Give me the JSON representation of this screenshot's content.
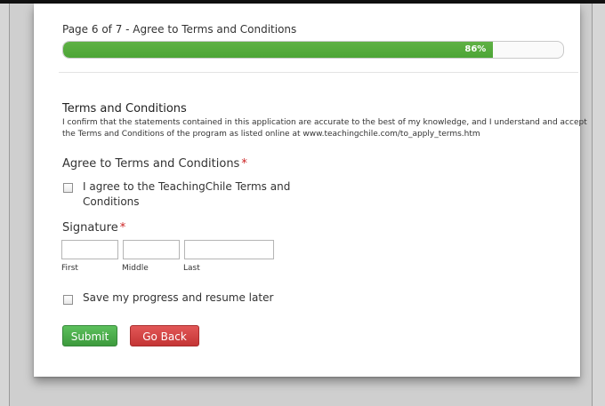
{
  "form": {
    "page_title": "Page 6 of 7 - Agree to Terms and Conditions",
    "progress": {
      "percent": 86,
      "label": "86%",
      "color": "#4ca536"
    },
    "terms_section": {
      "heading": "Terms and Conditions",
      "description": "I confirm that the statements contained in this application are accurate to the best of my knowledge, and I understand and accept the Terms and Conditions of the program as listed online at www.teachingchile.com/to_apply_terms.htm"
    },
    "agree_field": {
      "label": "Agree to Terms and Conditions",
      "required_mark": "*",
      "checkbox_line1": "I agree to the TeachingChile Terms and",
      "checkbox_line2": "Conditions",
      "checked": false
    },
    "signature": {
      "label": "Signature",
      "required_mark": "*",
      "first": {
        "value": "",
        "sublabel": "First"
      },
      "middle": {
        "value": "",
        "sublabel": "Middle"
      },
      "last": {
        "value": "",
        "sublabel": "Last"
      }
    },
    "save_progress": {
      "label": "Save my progress and resume later",
      "checked": false
    },
    "buttons": {
      "submit": "Submit",
      "go_back": "Go Back"
    }
  }
}
